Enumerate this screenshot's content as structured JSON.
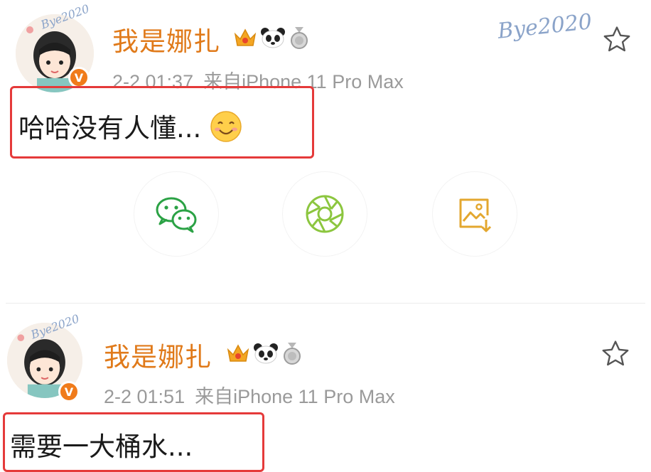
{
  "posts": [
    {
      "username": "我是娜扎",
      "time": "2-2 01:37",
      "source": "来自iPhone 11 Pro Max",
      "content": "哈哈没有人懂...",
      "avatar_caption": "Bye2020",
      "verified_badge": "V"
    },
    {
      "username": "我是娜扎",
      "time": "2-2 01:51",
      "source": "来自iPhone 11 Pro Max",
      "content": "需要一大桶水...",
      "avatar_caption": "Bye2020",
      "verified_badge": "V"
    }
  ],
  "decoration": {
    "watermark": "Bye2020"
  },
  "share_actions": [
    {
      "icon": "wechat-icon",
      "color": "#2ba245"
    },
    {
      "icon": "moments-icon",
      "color": "#8cc63f"
    },
    {
      "icon": "save-image-icon",
      "color": "#e3a72f"
    }
  ],
  "colors": {
    "username": "#e07a1a",
    "meta": "#9a9a9a",
    "highlight": "#e53a3a",
    "verified": "#f07b1a"
  }
}
